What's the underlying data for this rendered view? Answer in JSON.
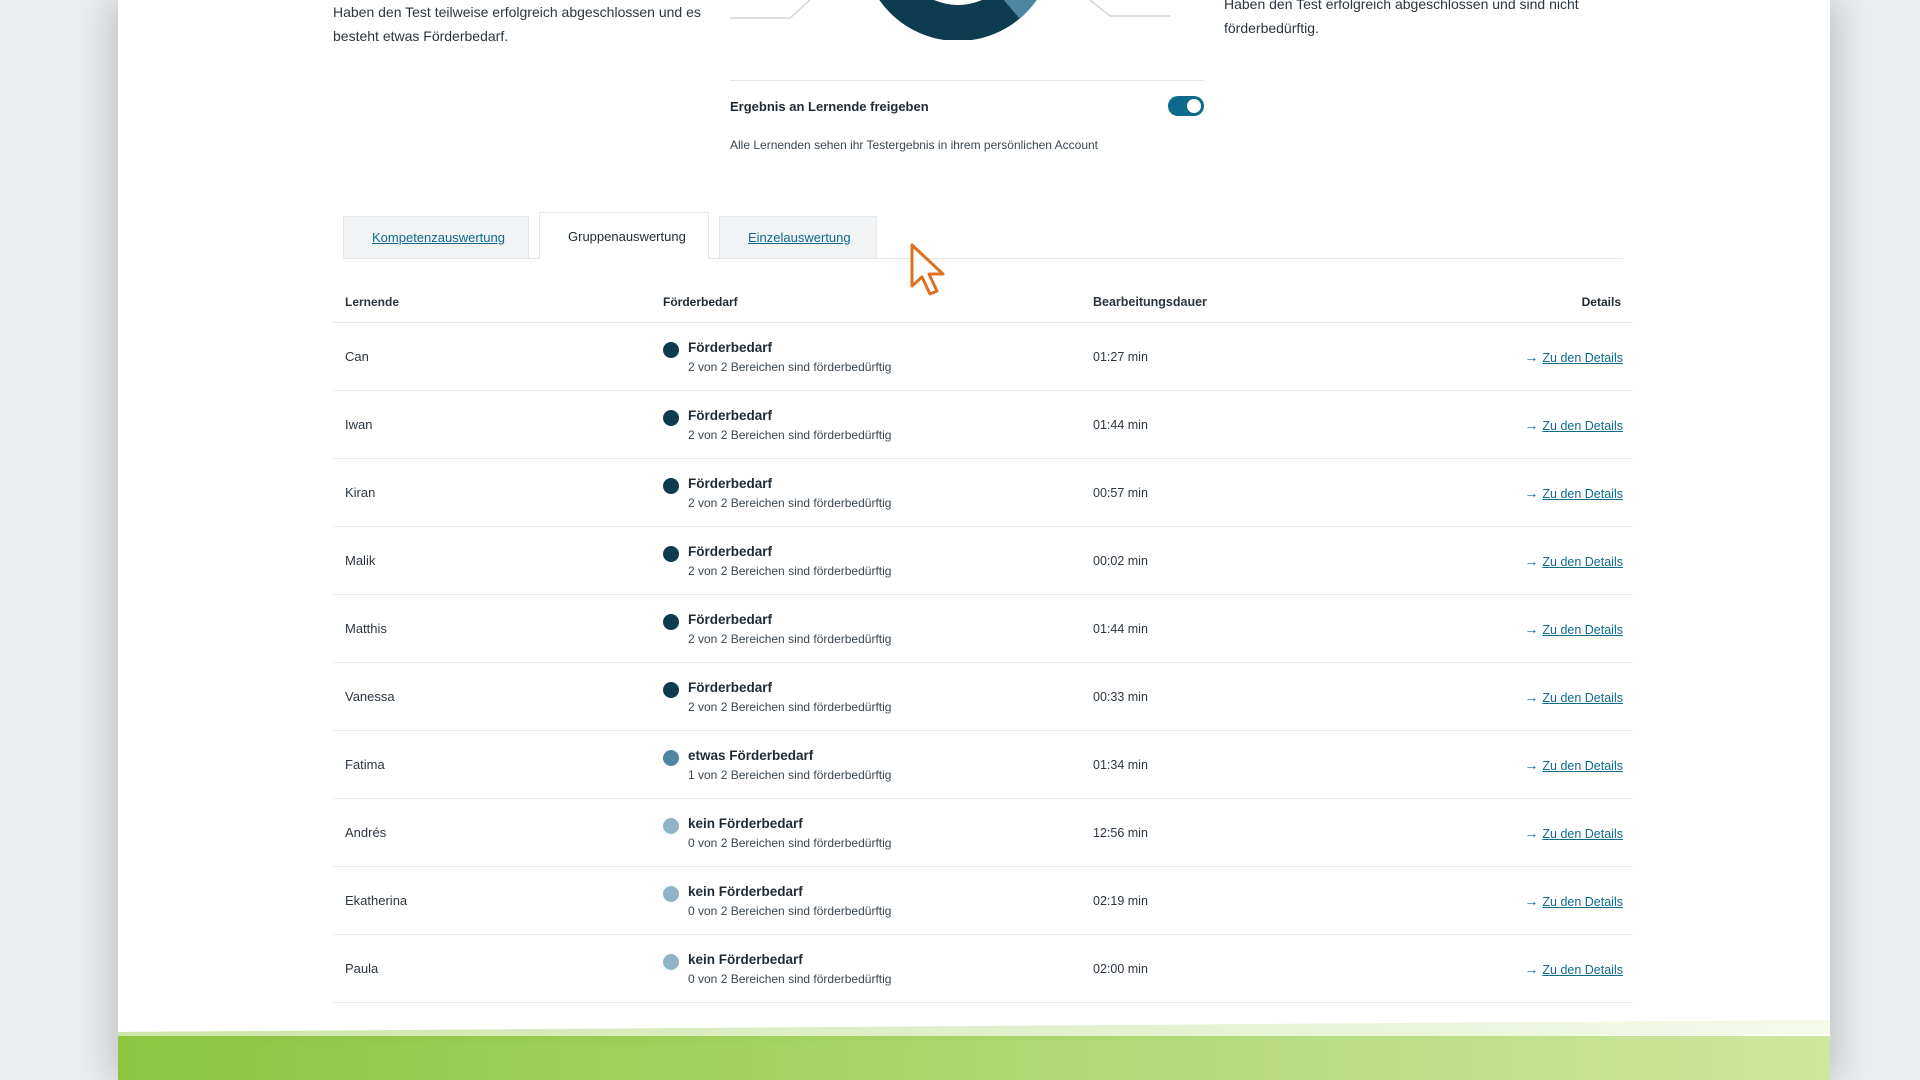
{
  "intro": {
    "left_text": "Haben den Test teilweise erfolgreich abgeschlossen und es besteht etwas Förderbedarf.",
    "right_text": "Haben den Test erfolgreich abgeschlossen und sind nicht förderbedürftig."
  },
  "release": {
    "label": "Ergebnis an Lernende freigeben",
    "enabled": true,
    "hint": "Alle Lernenden sehen ihr Testergebnis in ihrem persönlichen Account"
  },
  "tabs": [
    {
      "label": "Kompetenzauswertung",
      "active": false
    },
    {
      "label": "Gruppenauswertung",
      "active": true
    },
    {
      "label": "Einzelauswertung",
      "active": false
    }
  ],
  "table": {
    "headers": {
      "name": "Lernende",
      "need": "Förderbedarf",
      "duration": "Bearbeitungsdauer",
      "details": "Details"
    },
    "rows": [
      {
        "name": "Can",
        "need": "Förderbedarf",
        "sub": "2 von 2 Bereichen sind förderbedürftig",
        "duration": "01:27 min",
        "link": "Zu den Details",
        "dot": "#0d3b4f"
      },
      {
        "name": "Iwan",
        "need": "Förderbedarf",
        "sub": "2 von 2 Bereichen sind förderbedürftig",
        "duration": "01:44 min",
        "link": "Zu den Details",
        "dot": "#0d3b4f"
      },
      {
        "name": "Kiran",
        "need": "Förderbedarf",
        "sub": "2 von 2 Bereichen sind förderbedürftig",
        "duration": "00:57 min",
        "link": "Zu den Details",
        "dot": "#0d3b4f"
      },
      {
        "name": "Malik",
        "need": "Förderbedarf",
        "sub": "2 von 2 Bereichen sind förderbedürftig",
        "duration": "00:02 min",
        "link": "Zu den Details",
        "dot": "#0d3b4f"
      },
      {
        "name": "Matthis",
        "need": "Förderbedarf",
        "sub": "2 von 2 Bereichen sind förderbedürftig",
        "duration": "01:44 min",
        "link": "Zu den Details",
        "dot": "#0d3b4f"
      },
      {
        "name": "Vanessa",
        "need": "Förderbedarf",
        "sub": "2 von 2 Bereichen sind förderbedürftig",
        "duration": "00:33 min",
        "link": "Zu den Details",
        "dot": "#0d3b4f"
      },
      {
        "name": "Fatima",
        "need": "etwas Förderbedarf",
        "sub": "1 von 2 Bereichen sind förderbedürftig",
        "duration": "01:34 min",
        "link": "Zu den Details",
        "dot": "#4f87a3"
      },
      {
        "name": "Andrés",
        "need": "kein Förderbedarf",
        "sub": "0 von 2 Bereichen sind förderbedürftig",
        "duration": "12:56 min",
        "link": "Zu den Details",
        "dot": "#8fb5c9"
      },
      {
        "name": "Ekatherina",
        "need": "kein Förderbedarf",
        "sub": "0 von 2 Bereichen sind förderbedürftig",
        "duration": "02:19 min",
        "link": "Zu den Details",
        "dot": "#8fb5c9"
      },
      {
        "name": "Paula",
        "need": "kein Förderbedarf",
        "sub": "0 von 2 Bereichen sind förderbedürftig",
        "duration": "02:00 min",
        "link": "Zu den Details",
        "dot": "#8fb5c9"
      }
    ]
  },
  "icons": {
    "arrow": "arrow-right-icon",
    "cursor": "mouse-pointer-icon"
  },
  "colors": {
    "accent": "#0e6a8c",
    "cursor": "#e07020",
    "footer": "#8cc63f"
  }
}
